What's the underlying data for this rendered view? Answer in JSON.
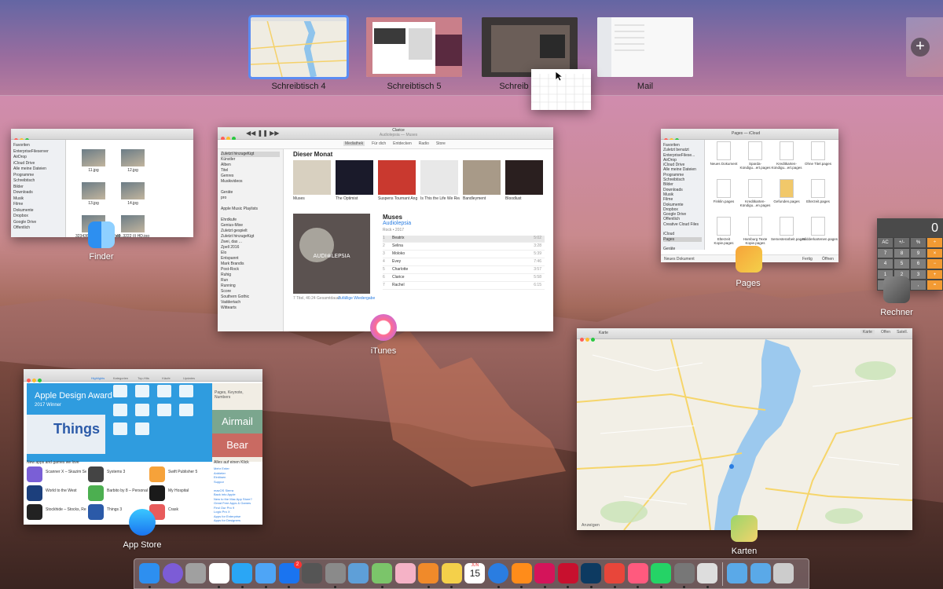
{
  "spaces": [
    {
      "label": "Schreibtisch 4",
      "active": true
    },
    {
      "label": "Schreibtisch 5",
      "active": false
    },
    {
      "label": "Schreib",
      "active": false
    },
    {
      "label": "Mail",
      "active": false
    }
  ],
  "add_space_symbol": "+",
  "apps": {
    "finder": {
      "label": "Finder"
    },
    "itunes": {
      "label": "iTunes"
    },
    "pages": {
      "label": "Pages"
    },
    "rechner": {
      "label": "Rechner"
    },
    "appstore": {
      "label": "App Store"
    },
    "karten": {
      "label": "Karten"
    }
  },
  "finder_window": {
    "sidebar": [
      "Favoriten",
      "EnterpriseFileserver",
      "AirDrop",
      "iCloud Drive",
      "Alle meine Dateien",
      "Programme",
      "Schreibtisch",
      "Bilder",
      "Downloads",
      "Musik",
      "Filme",
      "Dokumente",
      "Dropbox",
      "Google Drive",
      "Öffentlich"
    ],
    "files": [
      "11.jpg",
      "12.jpg",
      "13.jpg",
      "14.jpg",
      "323436_voloped_stadfadt...",
      "40_3222 (i) HD.jpg"
    ]
  },
  "itunes_window": {
    "now_playing": "Clarice",
    "now_artist": "Audiolepsia — Muses",
    "tabs": [
      "Mediathek",
      "Für dich",
      "Entdecken",
      "Radio",
      "Store"
    ],
    "sidebar": [
      "Zuletzt hinzugefügt",
      "Künstler",
      "Alben",
      "Titel",
      "Genres",
      "Musikvideos",
      "",
      "Geräte",
      "pro",
      "",
      "Apple Music Playlists",
      "",
      "Ehrdkufe",
      "Genius-Mixe",
      "Zuletzt gespielt",
      "Zuletzt hinzugefügt",
      "Zwei, das ...",
      "Zpell 2016",
      "Elo",
      "Entspannt",
      "Mark Brandis",
      "Post-Rock",
      "Ruhig",
      "Run",
      "Running",
      "Score",
      "Southern Gothic",
      "Vaddertach",
      "Wittearts"
    ],
    "section_title": "Dieser Monat",
    "albums": [
      "Muses",
      "The Optimist",
      "Suspens Tournant Angel...",
      "Is This the Life We Really...",
      "Bandleyment",
      "Bloodlust"
    ],
    "album_name": "Muses",
    "album_artist": "Audiolepsia",
    "album_meta": "Rock • 2017",
    "tracks": [
      "Beatrix",
      "Selina",
      "Moloko",
      "Evey",
      "Charlotte",
      "Clarice",
      "Rachel"
    ],
    "durations": [
      "5:02",
      "3:28",
      "5:39",
      "7:46",
      "3:57",
      "5:58",
      "6:15"
    ],
    "footer": "7 Titel, 46:24 Gesamtdauer",
    "footer_link": "Zufällige Wiedergabe"
  },
  "pages_window": {
    "title": "Pages — iCloud",
    "sidebar": [
      "Favoriten",
      "Zuletzt benutzt",
      "EnterpriseFilese...",
      "AirDrop",
      "iCloud Drive",
      "Alle meine Dateien",
      "Programme",
      "Schreibtisch",
      "Bilder",
      "Downloads",
      "Musik",
      "Filme",
      "Dokumente",
      "Dropbox",
      "Google Drive",
      "Öffentlich",
      "Creative Cloud Files",
      "",
      "iCloud",
      "Pages",
      "",
      "Geräte"
    ],
    "files": [
      "Neues Dokument",
      "Sparda-Kündigu...ert.pages",
      "Kreditkarten-Kündigu...ert.pages",
      "Ohne Titel.pages",
      "Finklin.pages",
      "Kreditkarten-Kündigu...en.pages",
      "Gefunden.pages",
      "Elterzeit.pages",
      "Elterzeit Kopie.pages",
      "Hamburg Texte Kopie.pages",
      "Semesterarbeit.pages",
      "Bildderkartenen.pages"
    ],
    "footer_left": "Neues Dokument",
    "footer_btn1": "Fertig",
    "footer_btn2": "Öffnen"
  },
  "calculator": {
    "display": "0",
    "keys": [
      "AC",
      "+/-",
      "%",
      "÷",
      "7",
      "8",
      "9",
      "×",
      "4",
      "5",
      "6",
      "−",
      "1",
      "2",
      "3",
      "+",
      "0",
      ",",
      "="
    ]
  },
  "appstore_window": {
    "tabs": [
      "Highlights",
      "Kategorien",
      "Top-Hits",
      "Käufe",
      "Updates"
    ],
    "banner_title": "Apple Design Award",
    "banner_sub": "2017 Winner",
    "banner_app": "Things",
    "side_top": "Pages, Keynote, Numbers",
    "side_app1": "Airmail",
    "side_app2": "Bear",
    "section": "New apps and games we love",
    "apps": [
      "Scanner X – Skazim Se Ve...",
      "Systems 3",
      "Swift Publisher 5",
      "World to the West",
      "Barbito by 8 – Personal Fine...",
      "My Hospital",
      "Stockhide – Stocks, Real Ti...",
      "Things 3",
      "Crask"
    ],
    "side_header": "Alles auf einen Klick",
    "side_links": [
      "Mehr Enter",
      "Anbieter",
      "Einlösen",
      "Suppor",
      "",
      "macOS Sierra",
      "Back into Apple",
      "New to the Mac App Store?",
      "Great Free Apps & Games",
      "Find Our Pro 9",
      "Logic Pro X",
      "Apps for Enterprise",
      "Apps for Designers"
    ]
  },
  "maps_window": {
    "title": "Karte",
    "buttons": [
      "Karte",
      "Offen",
      "Satell."
    ],
    "bottom_left": "Anzeigen"
  },
  "dock_items": [
    "finder-icon",
    "siri-icon",
    "launchpad-icon",
    "notes-icon",
    "messages-icon",
    "mail-icon",
    "appstore-icon",
    "photobooth-icon",
    "system-preferences-icon",
    "preview-icon",
    "maps-icon",
    "photos-icon",
    "books-icon",
    "notes-yellow-icon",
    "calendar-icon",
    "safari-icon",
    "sublime-icon",
    "indesign-icon",
    "acrobat-icon",
    "photoshop-icon",
    "chrome-icon",
    "itunes-icon",
    "whatsapp-icon",
    "calculator-icon",
    "scrivener-icon",
    "downloads-folder-icon",
    "documents-folder-icon",
    "trash-icon"
  ],
  "dock_badge": "2",
  "calendar_day": "15",
  "calendar_month": "JUN",
  "itunes_badge": "30"
}
